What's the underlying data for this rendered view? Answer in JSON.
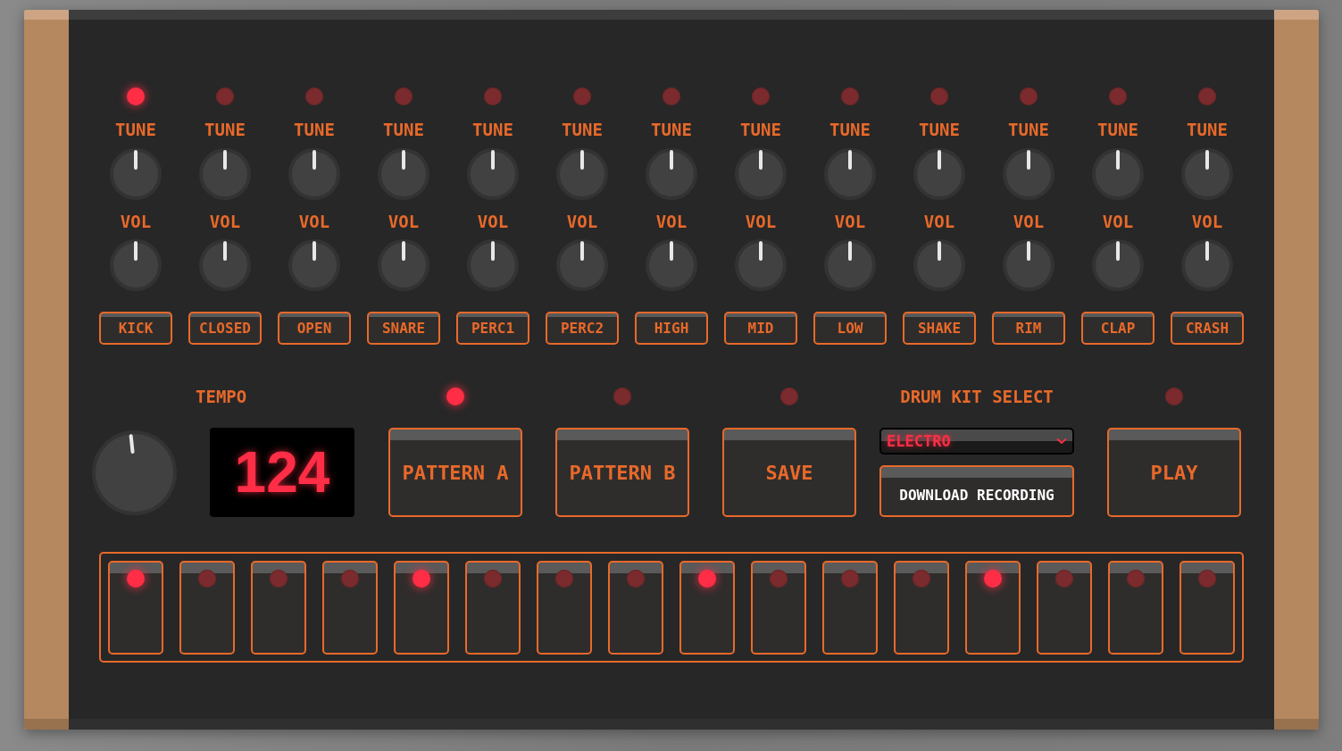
{
  "channels": [
    {
      "name": "KICK",
      "led_on": true,
      "tune_label": "TUNE",
      "vol_label": "VOL"
    },
    {
      "name": "CLOSED",
      "led_on": false,
      "tune_label": "TUNE",
      "vol_label": "VOL"
    },
    {
      "name": "OPEN",
      "led_on": false,
      "tune_label": "TUNE",
      "vol_label": "VOL"
    },
    {
      "name": "SNARE",
      "led_on": false,
      "tune_label": "TUNE",
      "vol_label": "VOL"
    },
    {
      "name": "PERC1",
      "led_on": false,
      "tune_label": "TUNE",
      "vol_label": "VOL"
    },
    {
      "name": "PERC2",
      "led_on": false,
      "tune_label": "TUNE",
      "vol_label": "VOL"
    },
    {
      "name": "HIGH",
      "led_on": false,
      "tune_label": "TUNE",
      "vol_label": "VOL"
    },
    {
      "name": "MID",
      "led_on": false,
      "tune_label": "TUNE",
      "vol_label": "VOL"
    },
    {
      "name": "LOW",
      "led_on": false,
      "tune_label": "TUNE",
      "vol_label": "VOL"
    },
    {
      "name": "SHAKE",
      "led_on": false,
      "tune_label": "TUNE",
      "vol_label": "VOL"
    },
    {
      "name": "RIM",
      "led_on": false,
      "tune_label": "TUNE",
      "vol_label": "VOL"
    },
    {
      "name": "CLAP",
      "led_on": false,
      "tune_label": "TUNE",
      "vol_label": "VOL"
    },
    {
      "name": "CRASH",
      "led_on": false,
      "tune_label": "TUNE",
      "vol_label": "VOL"
    }
  ],
  "tempo": {
    "label": "TEMPO",
    "value": "124"
  },
  "controls": [
    {
      "kind": "button",
      "label": "PATTERN A",
      "led_on": true
    },
    {
      "kind": "button",
      "label": "PATTERN B",
      "led_on": false
    },
    {
      "kind": "button",
      "label": "SAVE",
      "led_on": false
    },
    {
      "kind": "kit",
      "label": "DRUM KIT SELECT",
      "value": "ELECTRO",
      "action": "DOWNLOAD RECORDING"
    },
    {
      "kind": "button",
      "label": "PLAY",
      "led_on": false
    }
  ],
  "steps": [
    {
      "on": true
    },
    {
      "on": false
    },
    {
      "on": false
    },
    {
      "on": false
    },
    {
      "on": true
    },
    {
      "on": false
    },
    {
      "on": false
    },
    {
      "on": false
    },
    {
      "on": true
    },
    {
      "on": false
    },
    {
      "on": false
    },
    {
      "on": false
    },
    {
      "on": true
    },
    {
      "on": false
    },
    {
      "on": false
    },
    {
      "on": false
    }
  ]
}
